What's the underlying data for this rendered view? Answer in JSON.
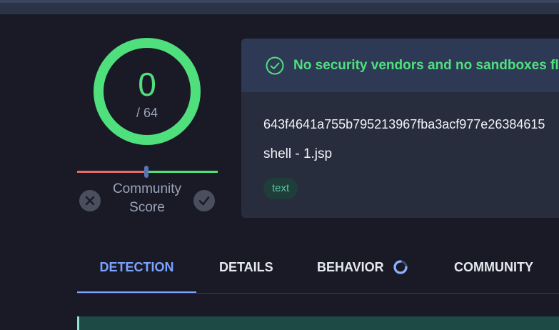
{
  "score": {
    "value": "0",
    "total": "/ 64",
    "ring_color": "#4fe07d",
    "community": {
      "label_line1": "Community",
      "label_line2": "Score",
      "negative_color": "#e36b6b",
      "positive_color": "#4fe07d",
      "downvote_icon": "x-icon",
      "upvote_icon": "check-icon"
    }
  },
  "report": {
    "status_icon": "check-circle-icon",
    "status_text": "No security vendors and no sandboxes fla",
    "hash": "643f4641a755b795213967fba3acf977e26384615",
    "filename": "shell - 1.jsp",
    "tag": "text"
  },
  "tabs": {
    "items": [
      {
        "label": "DETECTION",
        "active": true
      },
      {
        "label": "DETAILS",
        "active": false
      },
      {
        "label": "BEHAVIOR",
        "active": false,
        "icon": "loading-spinner-icon"
      },
      {
        "label": "COMMUNITY",
        "active": false
      }
    ]
  },
  "colors": {
    "background": "#1a1a26",
    "accent": "#7aa3ff",
    "clean": "#4fe07d"
  }
}
